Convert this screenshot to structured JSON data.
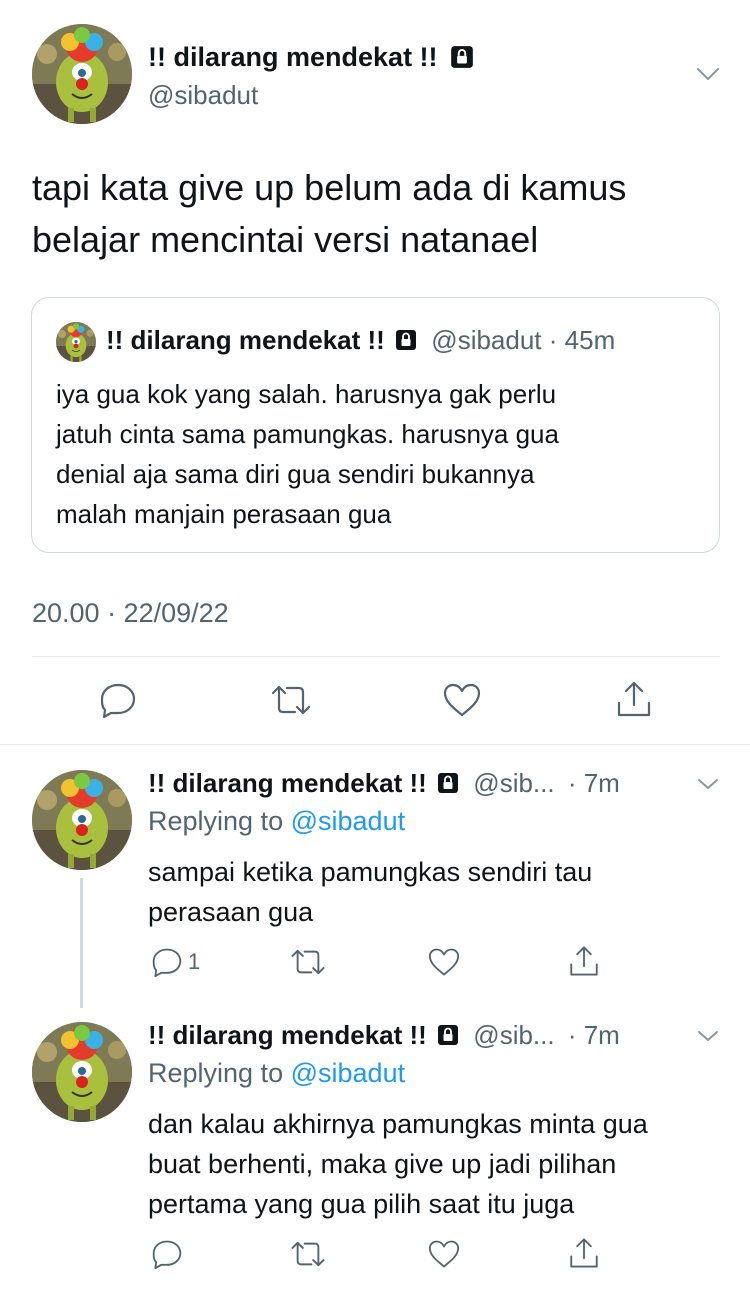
{
  "main_tweet": {
    "display_name": "!! dilarang mendekat !!",
    "handle": "@sibadut",
    "text_lines": [
      "tapi kata give up belum ada di kamus",
      "belajar mencintai versi natanael"
    ],
    "timestamp": "20.00 · 22/09/22"
  },
  "quoted_tweet": {
    "display_name": "!! dilarang mendekat !!",
    "handle": "@sibadut",
    "time": "· 45m",
    "text_lines": [
      "iya gua kok yang salah. harusnya gak perlu",
      "jatuh cinta sama pamungkas. harusnya gua",
      "denial aja sama diri gua sendiri bukannya",
      "malah manjain perasaan gua"
    ]
  },
  "replies": [
    {
      "display_name": "!! dilarang mendekat !!",
      "handle": "@sib...",
      "time": "· 7m",
      "replying_prefix": "Replying to",
      "replying_handle": "@sibadut",
      "text_lines": [
        "sampai ketika pamungkas sendiri tau",
        "perasaan gua"
      ],
      "reply_count": "1"
    },
    {
      "display_name": "!! dilarang mendekat !!",
      "handle": "@sib...",
      "time": "· 7m",
      "replying_prefix": "Replying to",
      "replying_handle": "@sibadut",
      "text_lines": [
        "dan kalau akhirnya pamungkas minta gua",
        "buat berhenti, maka give up jadi pilihan",
        "pertama yang gua pilih saat itu juga"
      ],
      "reply_count": ""
    }
  ],
  "colors": {
    "text": "#0f1419",
    "muted": "#536471",
    "link": "#1d9bf0",
    "border": "#cfd9de"
  }
}
